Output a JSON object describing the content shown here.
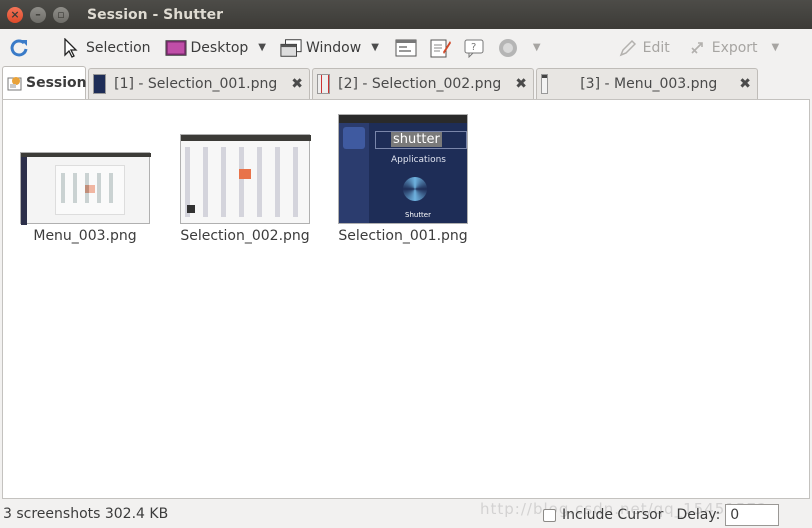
{
  "window": {
    "title": "Session - Shutter"
  },
  "toolbar": {
    "refresh_icon": "refresh-icon",
    "selection_label": "Selection",
    "desktop_label": "Desktop",
    "window_label": "Window",
    "edit_label": "Edit",
    "export_label": "Export"
  },
  "tabs": [
    {
      "label": "Session",
      "active": true
    },
    {
      "label": "[1] - Selection_001.png"
    },
    {
      "label": "[2] - Selection_002.png"
    },
    {
      "label": "[3] - Menu_003.png"
    }
  ],
  "tab_close_glyph": "✖",
  "session": {
    "items": [
      {
        "label": "Menu_003.png"
      },
      {
        "label": "Selection_002.png"
      },
      {
        "label": "Selection_001.png"
      }
    ],
    "thumb_search_text": "shutter",
    "thumb_applications": "Applications",
    "thumb_shutter": "Shutter"
  },
  "status": {
    "summary": "3 screenshots  302.4 KB",
    "include_cursor_label": "Include Cursor",
    "delay_label": "Delay:",
    "delay_value": "0",
    "watermark": "http://blog.csdn.net/qq_15451572"
  },
  "colors": {
    "accent": "#de4a2a",
    "titlebar": "#3c3b37"
  }
}
